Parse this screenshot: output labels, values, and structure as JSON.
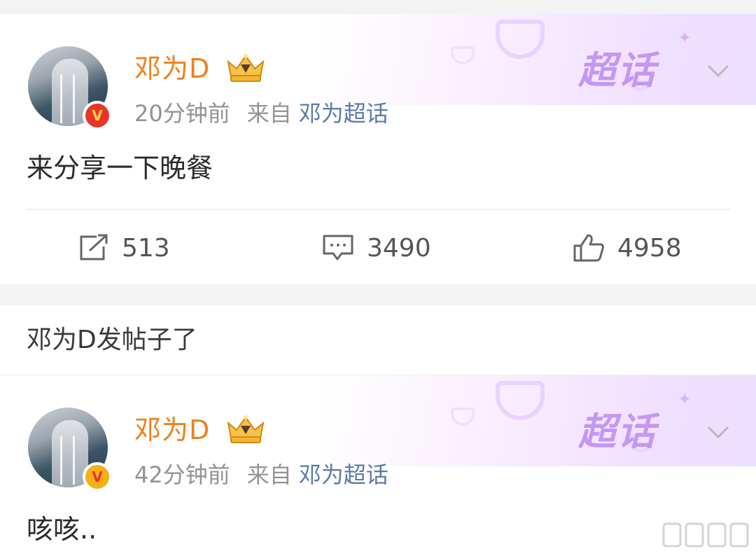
{
  "posts": [
    {
      "username": "邓为D",
      "time": "20分钟前",
      "from_label": "来自",
      "source": "邓为超话",
      "supertopic_label": "超话",
      "content": "来分享一下晚餐",
      "reposts": "513",
      "comments": "3490",
      "likes": "4958"
    },
    {
      "username": "邓为D",
      "time": "42分钟前",
      "from_label": "来自",
      "source": "邓为超话",
      "supertopic_label": "超话",
      "content": "咳咳.."
    }
  ],
  "notice": {
    "text": "邓为D发帖子了"
  },
  "icons": {
    "verified": "verified-v-badge-icon",
    "crown": "crown-badge-icon",
    "chevron": "chevron-down-icon",
    "repost": "repost-icon",
    "comment": "comment-icon",
    "like": "thumbs-up-icon"
  },
  "colors": {
    "username": "#f07f1c",
    "source_link": "#5b7aa7",
    "meta": "#939393",
    "supertopic": "#c596f2",
    "verified_red": "#e8352a",
    "verified_gold": "#f6b017"
  }
}
